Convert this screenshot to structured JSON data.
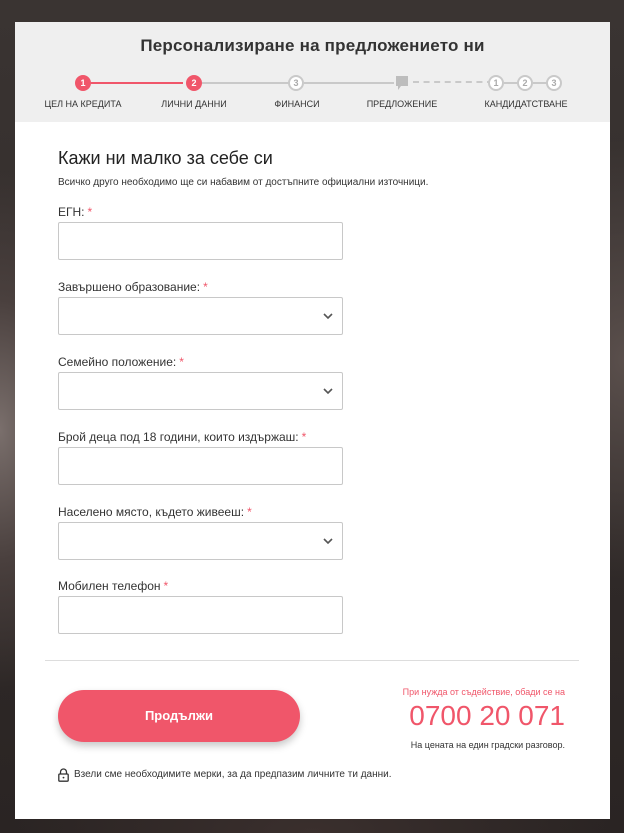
{
  "header": {
    "title": "Персонализиране на предложението ни",
    "steps": [
      {
        "number": "1",
        "label": "ЦЕЛ НА КРЕДИТА",
        "state": "done"
      },
      {
        "number": "2",
        "label": "ЛИЧНИ ДАННИ",
        "state": "current"
      },
      {
        "number": "3",
        "label": "ФИНАНСИ",
        "state": "upcoming"
      },
      {
        "icon": "flag-icon",
        "label": "ПРЕДЛОЖЕНИЕ",
        "state": "upcoming"
      },
      {
        "numbers": [
          "1",
          "2",
          "3"
        ],
        "label": "КАНДИДАТСТВАНЕ",
        "state": "upcoming"
      }
    ]
  },
  "section": {
    "title": "Кажи ни малко за себе си",
    "subtitle": "Всичко друго необходимо ще си набавим от достъпните официални източници."
  },
  "form": {
    "required_mark": "*",
    "fields": [
      {
        "label": "ЕГН:",
        "type": "text",
        "value": ""
      },
      {
        "label": "Завършено образование:",
        "type": "select",
        "value": ""
      },
      {
        "label": "Семейно положение:",
        "type": "select",
        "value": ""
      },
      {
        "label": "Брой деца под 18 години, които издържаш:",
        "type": "text",
        "value": ""
      },
      {
        "label": "Населено място, където живееш:",
        "type": "select",
        "value": ""
      },
      {
        "label": "Мобилен телефон",
        "type": "text",
        "value": ""
      }
    ]
  },
  "actions": {
    "continue_label": "Продължи"
  },
  "help": {
    "text": "При нужда от съдействие, обади се на",
    "phone": "0700 20 071",
    "note": "На цената на един градски разговор."
  },
  "privacy": {
    "text": "Взели сме необходимите мерки, за да предпазим личните ти данни."
  },
  "colors": {
    "accent": "#f0566a",
    "inactive": "#c9c9c9",
    "header_bg": "#efefef"
  }
}
